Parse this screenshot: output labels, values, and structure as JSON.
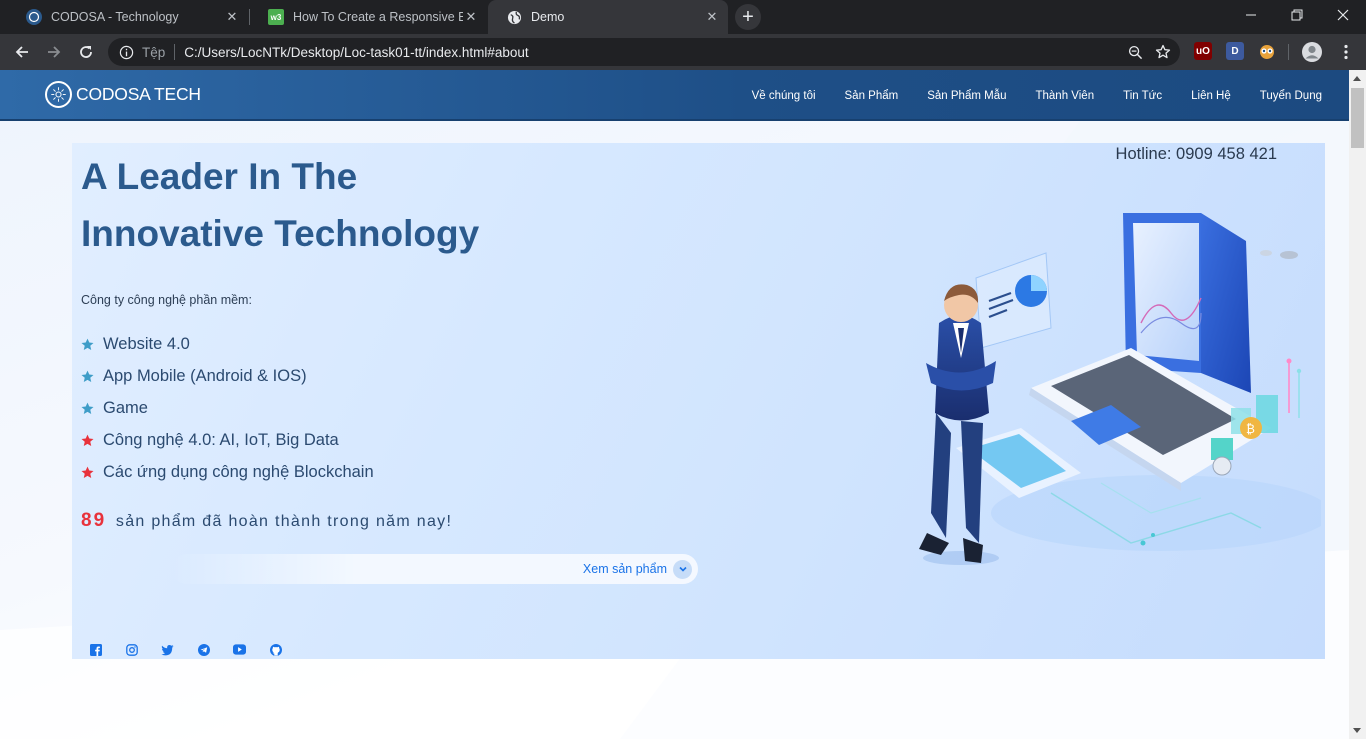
{
  "browser": {
    "tabs": [
      {
        "title": "CODOSA - Technology",
        "active": false
      },
      {
        "title": "How To Create a Responsive Bott",
        "active": false
      },
      {
        "title": "Demo",
        "active": true
      }
    ],
    "scheme_label": "Tệp",
    "url": "C:/Users/LocNTk/Desktop/Loc-task01-tt/index.html#about",
    "extensions": [
      "uO",
      "D"
    ]
  },
  "site": {
    "logo_text": "CODOSA TECH",
    "menu": [
      "Về chúng tôi",
      "Sản Phẩm",
      "Sản Phẩm Mẫu",
      "Thành Viên",
      "Tin Tức",
      "Liên Hệ",
      "Tuyển Dụng"
    ],
    "hotline": "Hotline: 0909 458 421",
    "headline_line1": "A Leader In The",
    "headline_line2": "Innovative Technology",
    "intro": "Công ty công nghệ phần mềm:",
    "features": [
      {
        "label": "Website 4.0",
        "star_color": "#3f9dc8"
      },
      {
        "label": "App Mobile (Android & IOS)",
        "star_color": "#3f9dc8"
      },
      {
        "label": "Game",
        "star_color": "#3f9dc8"
      },
      {
        "label": "Công nghệ 4.0: AI, IoT, Big Data",
        "star_color": "#e8323c"
      },
      {
        "label": "Các ứng dụng công nghệ Blockchain",
        "star_color": "#e8323c"
      }
    ],
    "stat_number": "89",
    "stat_text": "sản phẩm đã hoàn thành trong năm nay!",
    "cta_label": "Xem sản phẩm",
    "social_icons": [
      "facebook-icon",
      "instagram-icon",
      "twitter-icon",
      "telegram-icon",
      "youtube-icon",
      "github-icon"
    ]
  },
  "colors": {
    "header_bg": "#2f6aa8",
    "headline": "#2b5a8d",
    "accent_red": "#e8323c",
    "link_blue": "#1a73e8"
  }
}
